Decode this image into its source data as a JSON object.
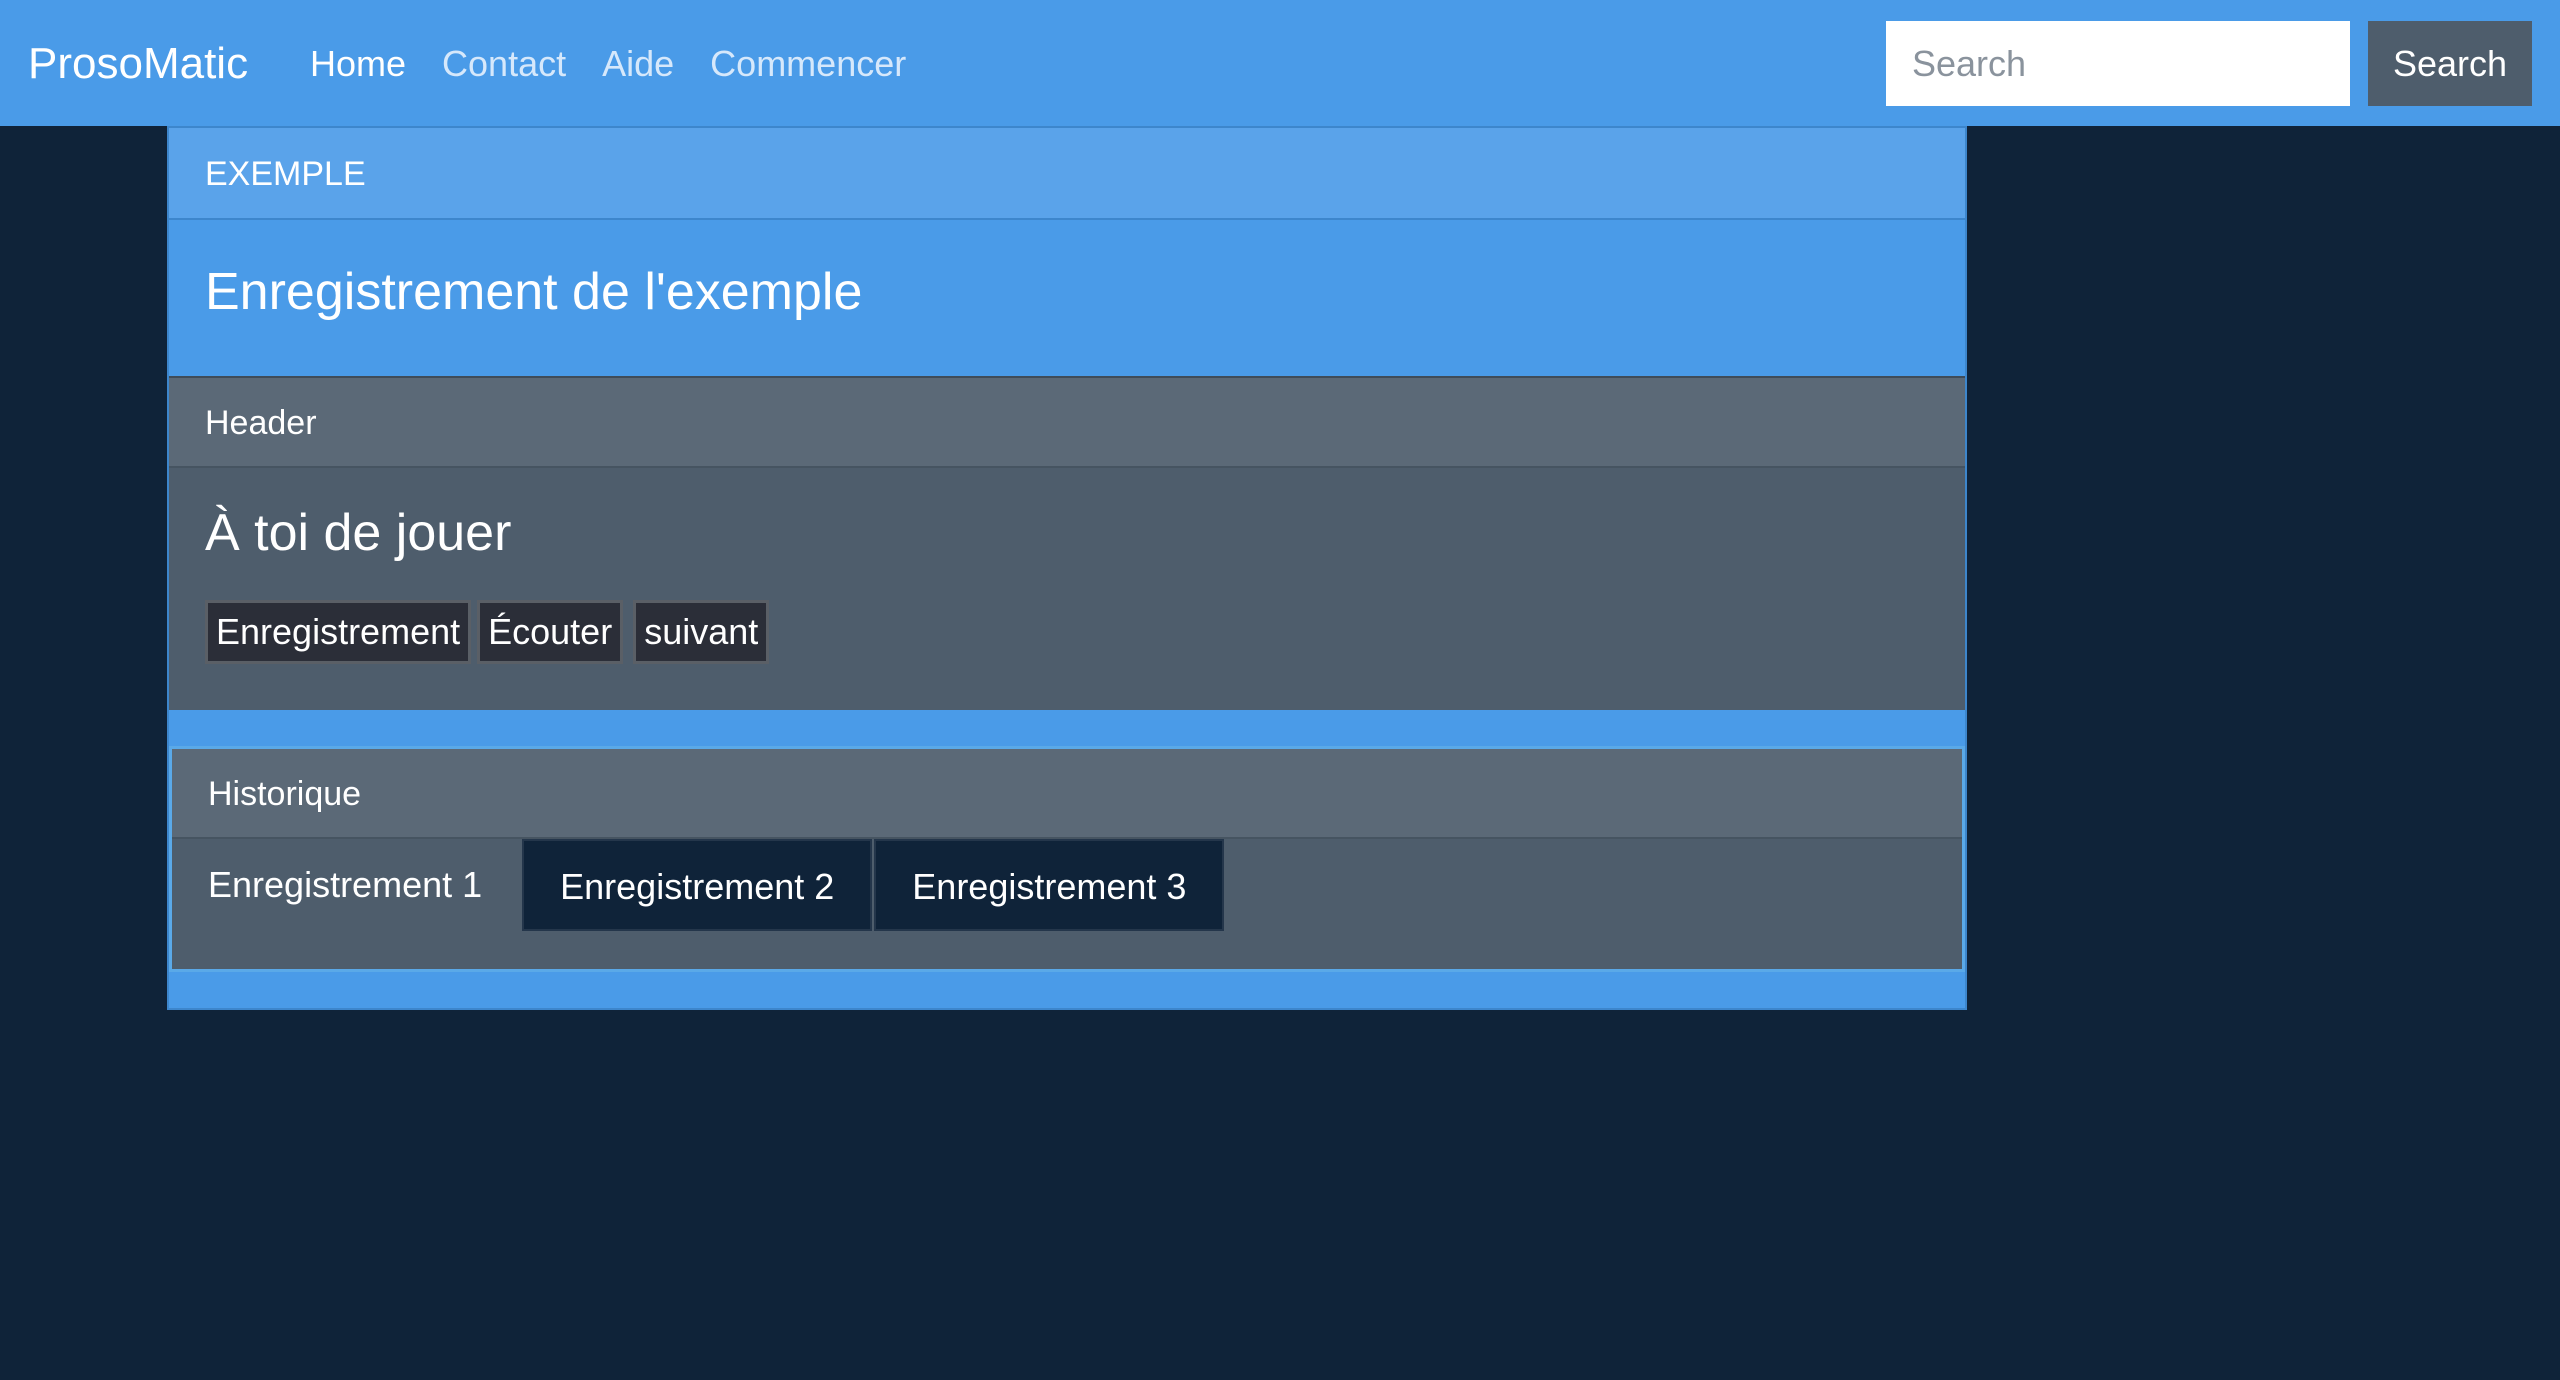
{
  "navbar": {
    "brand": "ProsoMatic",
    "links": [
      {
        "label": "Home",
        "active": true
      },
      {
        "label": "Contact",
        "active": false
      },
      {
        "label": "Aide",
        "active": false
      },
      {
        "label": "Commencer",
        "active": false
      }
    ],
    "search_placeholder": "Search",
    "search_button": "Search"
  },
  "example_card": {
    "header": "EXEMPLE",
    "title": "Enregistrement de l'exemple"
  },
  "play_card": {
    "header": "Header",
    "title": "À toi de jouer",
    "buttons": [
      "Enregistrement",
      "Écouter",
      "suivant"
    ]
  },
  "history_card": {
    "header": "Historique",
    "items": [
      "Enregistrement 1",
      "Enregistrement 2",
      "Enregistrement 3"
    ]
  },
  "colors": {
    "navbar_bg": "#4a9be8",
    "page_bg": "#0f2339",
    "card_gray": "#4e5d6c",
    "card_header_gray": "#5b6977",
    "dark_button": "#2b2e38"
  }
}
